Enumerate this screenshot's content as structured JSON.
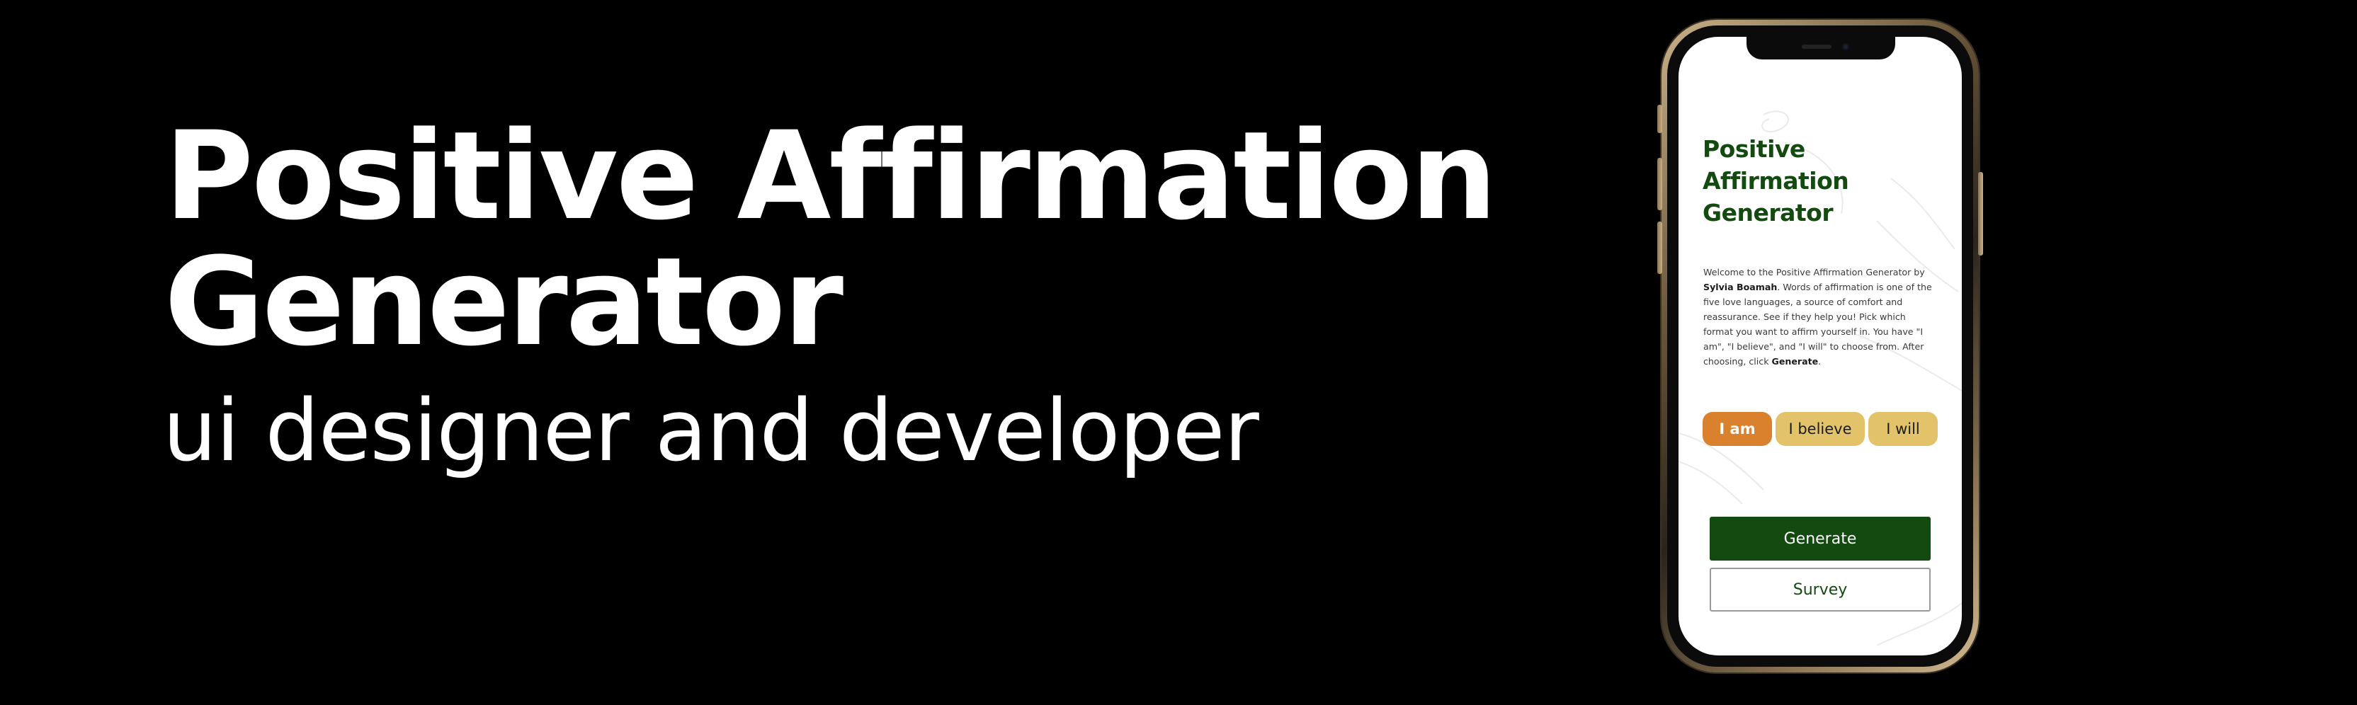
{
  "hero": {
    "title_line1": "Positive Affirmation",
    "title_line2": "Generator",
    "subtitle": "ui designer and developer"
  },
  "phone": {
    "app": {
      "title_line1": "Positive",
      "title_line2": "Affirmation",
      "title_line3": "Generator",
      "desc_part1": "Welcome to the Positive Affirmation Generator by ",
      "desc_author": "Sylvia Boamah",
      "desc_part2": ". Words of affirmation is one of the five love languages, a source of comfort and reassurance. See if they help you! Pick which format you want to affirm yourself in. You have \"I am\", \"I believe\", and \"I will\" to choose from. After choosing, click ",
      "desc_generate": "Generate",
      "desc_end": ".",
      "options": [
        {
          "label": "I am",
          "selected": true
        },
        {
          "label": "I believe",
          "selected": false
        },
        {
          "label": "I will",
          "selected": false
        }
      ],
      "generate_label": "Generate",
      "survey_label": "Survey"
    }
  },
  "colors": {
    "background": "#000000",
    "hero_text": "#ffffff",
    "brand_green": "#124a10",
    "chip_selected": "#d9812c",
    "chip_default": "#e3c36a"
  }
}
